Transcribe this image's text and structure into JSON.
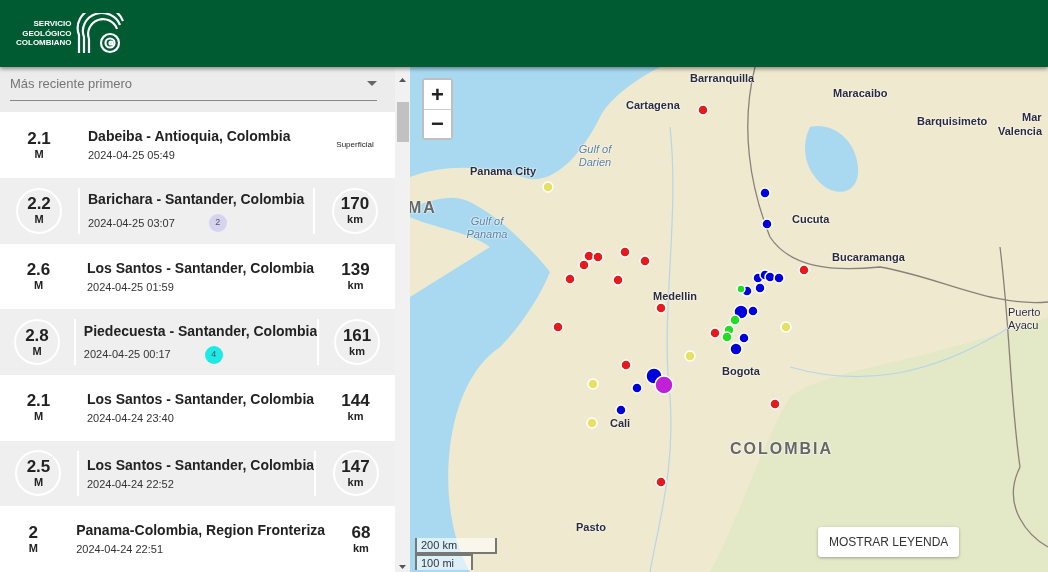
{
  "header": {
    "logo_lines": [
      "SERVICIO",
      "GEOLÓGICO",
      "COLOMBIANO"
    ]
  },
  "sort": {
    "value": "Más reciente primero"
  },
  "events": [
    {
      "magnitude": "2.1",
      "unit": "M",
      "location": "Dabeiba - Antioquia, Colombia",
      "time": "2024-04-25 05:49",
      "depth": "Superficial",
      "highlighted": false
    },
    {
      "magnitude": "2.2",
      "unit": "M",
      "location": "Barichara - Santander, Colombia",
      "time": "2024-04-25 03:07",
      "badge": "2",
      "color": "#d6d3f0",
      "depth": "170",
      "depth_unit": "km",
      "highlighted": true
    },
    {
      "magnitude": "2.6",
      "unit": "M",
      "location": "Los Santos - Santander, Colombia",
      "time": "2024-04-25 01:59",
      "depth": "139",
      "depth_unit": "km",
      "highlighted": false
    },
    {
      "magnitude": "2.8",
      "unit": "M",
      "location": "Piedecuesta - Santander, Colombia",
      "time": "2024-04-25 00:17",
      "badge": "4",
      "color": "#1de9e6",
      "depth": "161",
      "depth_unit": "km",
      "highlighted": true
    },
    {
      "magnitude": "2.1",
      "unit": "M",
      "location": "Los Santos - Santander, Colombia",
      "time": "2024-04-24 23:40",
      "depth": "144",
      "depth_unit": "km",
      "highlighted": false
    },
    {
      "magnitude": "2.5",
      "unit": "M",
      "location": "Los Santos - Santander, Colombia",
      "time": "2024-04-24 22:52",
      "depth": "147",
      "depth_unit": "km",
      "highlighted": true
    },
    {
      "magnitude": "2",
      "unit": "M",
      "location": "Panama-Colombia, Region Fronteriza",
      "time": "2024-04-24 22:51",
      "depth": "68",
      "depth_unit": "km",
      "highlighted": false
    }
  ],
  "map": {
    "zoom_in": "+",
    "zoom_out": "−",
    "labels": [
      {
        "text": "Barranquilla",
        "kind": "city"
      },
      {
        "text": "Cartagena",
        "kind": "city"
      },
      {
        "text": "Maracaibo",
        "kind": "city"
      },
      {
        "text": "Barquisimeto",
        "kind": "city"
      },
      {
        "text": "Mar",
        "kind": "city"
      },
      {
        "text": "Valencia",
        "kind": "city"
      },
      {
        "text": "Panama City",
        "kind": "city"
      },
      {
        "text": "Gulf of Darien",
        "kind": "water"
      },
      {
        "text": "Gulf of Panama",
        "kind": "water"
      },
      {
        "text": "MA",
        "kind": "country"
      },
      {
        "text": "Cucuta",
        "kind": "city"
      },
      {
        "text": "Bucaramanga",
        "kind": "city"
      },
      {
        "text": "Medellin",
        "kind": "city"
      },
      {
        "text": "Bogota",
        "kind": "city"
      },
      {
        "text": "Cali",
        "kind": "city"
      },
      {
        "text": "COLOMBIA",
        "kind": "country"
      },
      {
        "text": "Pasto",
        "kind": "city"
      },
      {
        "text": "Puerto Ayacu",
        "kind": "city"
      }
    ],
    "scale": [
      "200 km",
      "100 mi"
    ],
    "legend_button": "MOSTRAR LEYENDA"
  }
}
